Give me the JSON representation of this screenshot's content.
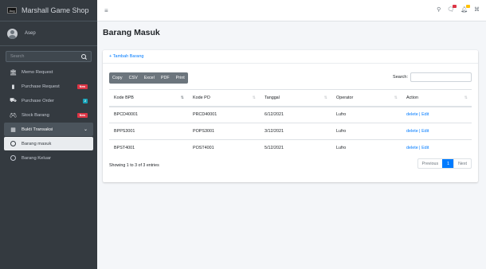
{
  "brand": {
    "logo_text": "Aug",
    "title": "Marshall Game Shop"
  },
  "user": {
    "name": "Asep"
  },
  "sidebar": {
    "search_placeholder": "Search",
    "items": [
      {
        "label": "Memo Request",
        "icon": "bank-icon"
      },
      {
        "label": "Purchase Request",
        "icon": "file-icon",
        "badge": "New"
      },
      {
        "label": "Purchase Order",
        "icon": "truck-icon",
        "badge": "2"
      },
      {
        "label": "Stock Barang",
        "icon": "gamepad-icon",
        "badge": "New"
      },
      {
        "label": "Bukti Transaksi",
        "icon": "table-icon"
      },
      {
        "label": "Barang masuk",
        "icon": "circle-icon"
      },
      {
        "label": "Barang Keluar",
        "icon": "circle-icon"
      }
    ]
  },
  "topbar": {
    "menu_icon": "hamburger-icon",
    "icons": [
      "search-icon",
      "comments-icon",
      "bell-icon",
      "expand-icon"
    ]
  },
  "page": {
    "title": "Barang Masuk"
  },
  "card": {
    "add_label": "+ Tambah Barang",
    "export_buttons": [
      "Copy",
      "CSV",
      "Excel",
      "PDF",
      "Print"
    ],
    "search_label": "Search:",
    "columns": [
      "Kode BPB",
      "Kode PO",
      "Tanggal",
      "Operator",
      "Action"
    ],
    "rows": [
      {
        "kode_bpb": "BPCD40001",
        "kode_po": "PRCD40001",
        "tanggal": "6/12/2021",
        "operator": "Lufro",
        "action": "delete | Edit"
      },
      {
        "kode_bpb": "BPPS3001",
        "kode_po": "POPS3001",
        "tanggal": "3/12/2021",
        "operator": "Lufro",
        "action": "delete | Edit"
      },
      {
        "kode_bpb": "BPST4001",
        "kode_po": "POST4001",
        "tanggal": "5/12/2021",
        "operator": "Lufro",
        "action": "delete | Edit"
      }
    ],
    "info": "Showing 1 to 3 of 3 entries",
    "pagination": {
      "previous": "Previous",
      "current": "1",
      "next": "Next"
    }
  },
  "colors": {
    "sidebar": "#343a40",
    "accent": "#007bff",
    "badge_new": "#dc3545",
    "badge_count": "#17a2b8"
  }
}
